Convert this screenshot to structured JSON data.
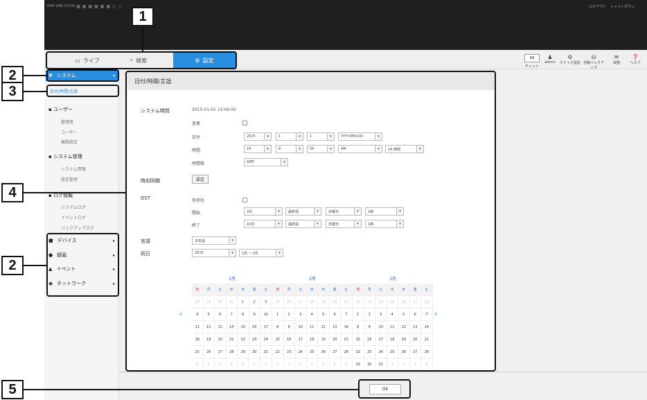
{
  "app": {
    "model": "NVR SRN-1673S",
    "logout": "ログアウト",
    "shutdown": "シャットダウン"
  },
  "tabs": [
    {
      "label": "ライブ"
    },
    {
      "label": "検索"
    },
    {
      "label": "設定"
    }
  ],
  "toolbar": {
    "ab_label": "AB",
    "chat_label": "チャット",
    "user_label": "admin",
    "quick_label": "クイック設定",
    "backup_label": "手動バックアップ",
    "alarm_label": "状態",
    "help_label": "ヘルプ"
  },
  "sidebar": {
    "system": "システム",
    "datetime": "日付/時間/言語",
    "groups": [
      {
        "title": "ユーザー",
        "items": [
          "管理者",
          "ユーザー",
          "権限設定"
        ]
      },
      {
        "title": "システム管理",
        "items": [
          "システム情報",
          "設定管理"
        ]
      },
      {
        "title": "ログ情報",
        "items": [
          "システムログ",
          "イベントログ",
          "バックアップログ"
        ]
      }
    ],
    "categories": [
      "デバイス",
      "録画",
      "イベント",
      "ネットワーク"
    ]
  },
  "panel": {
    "title": "日付/時間/言語",
    "system_time_label": "システム時間",
    "system_time_value": "2015-01-01 10:09:00",
    "change_label": "変更",
    "date_label": "日付",
    "date_year": "2015",
    "date_month": "1",
    "date_day": "1",
    "date_format": "YYYY-MM-DD",
    "time_label": "時間",
    "time_h": "10",
    "time_m": "8",
    "time_s": "59",
    "time_ampm": "AM",
    "time_fmt": "24 時間",
    "tz_label": "時間帯",
    "tz_value": "GMT",
    "sync_label": "時刻同期",
    "sync_btn": "設定",
    "dst_label": "DST",
    "dst_enable": "有効化",
    "dst_start": "開始",
    "dst_end": "終了",
    "dst_start_m": "3月",
    "dst_start_w": "最終週",
    "dst_start_d": "日曜日",
    "dst_start_h": "1時",
    "dst_end_m": "10月",
    "dst_end_w": "最終週",
    "dst_end_d": "日曜日",
    "dst_end_h": "1時",
    "lang_label": "言語",
    "lang_value": "日本語",
    "holiday_label": "祝日",
    "holiday_year": "2015",
    "holiday_range": "1月 ~ 3月",
    "ok": "OK"
  },
  "calendar": {
    "weekdays": [
      "日",
      "月",
      "火",
      "水",
      "木",
      "金",
      "土"
    ],
    "months": [
      {
        "title": "1月",
        "days": [
          [
            "28",
            "29",
            "30",
            "31",
            "1",
            "2",
            "3"
          ],
          [
            "4",
            "5",
            "6",
            "7",
            "8",
            "9",
            "10"
          ],
          [
            "11",
            "12",
            "13",
            "14",
            "15",
            "16",
            "17"
          ],
          [
            "18",
            "19",
            "20",
            "21",
            "22",
            "23",
            "24"
          ],
          [
            "25",
            "26",
            "27",
            "28",
            "29",
            "30",
            "31"
          ],
          [
            "1",
            "2",
            "3",
            "4",
            "5",
            "6",
            "7"
          ]
        ],
        "dim": [
          [
            0,
            1,
            2,
            3
          ],
          [],
          [],
          [],
          [],
          [
            0,
            1,
            2,
            3,
            4,
            5,
            6
          ]
        ]
      },
      {
        "title": "2月",
        "days": [
          [
            "25",
            "26",
            "27",
            "28",
            "29",
            "30",
            "31"
          ],
          [
            "1",
            "2",
            "3",
            "4",
            "5",
            "6",
            "7"
          ],
          [
            "8",
            "9",
            "10",
            "11",
            "12",
            "13",
            "14"
          ],
          [
            "15",
            "16",
            "17",
            "18",
            "19",
            "20",
            "21"
          ],
          [
            "22",
            "23",
            "24",
            "25",
            "26",
            "27",
            "28"
          ],
          [
            "1",
            "2",
            "3",
            "4",
            "5",
            "6",
            "7"
          ]
        ],
        "dim": [
          [
            0,
            1,
            2,
            3,
            4,
            5,
            6
          ],
          [],
          [],
          [],
          [],
          [
            0,
            1,
            2,
            3,
            4,
            5,
            6
          ]
        ]
      },
      {
        "title": "3月",
        "days": [
          [
            "22",
            "23",
            "24",
            "25",
            "26",
            "27",
            "28"
          ],
          [
            "1",
            "2",
            "3",
            "4",
            "5",
            "6",
            "7"
          ],
          [
            "8",
            "9",
            "10",
            "11",
            "12",
            "13",
            "14"
          ],
          [
            "15",
            "16",
            "17",
            "18",
            "19",
            "20",
            "21"
          ],
          [
            "22",
            "23",
            "24",
            "25",
            "26",
            "27",
            "28"
          ],
          [
            "29",
            "30",
            "31",
            "1",
            "2",
            "3",
            "4"
          ]
        ],
        "dim": [
          [
            0,
            1,
            2,
            3,
            4,
            5,
            6
          ],
          [],
          [],
          [],
          [],
          [
            3,
            4,
            5,
            6
          ]
        ]
      }
    ]
  },
  "callouts": [
    "1",
    "2",
    "3",
    "4",
    "2",
    "5"
  ]
}
